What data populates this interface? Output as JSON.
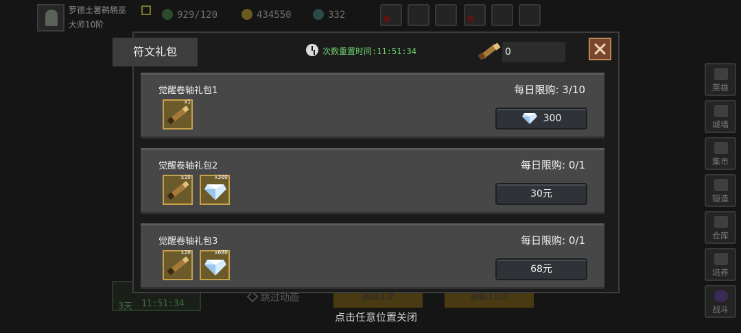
{
  "player": {
    "name": "罗德土著鹈鹕巫",
    "rank": "大师10阶"
  },
  "stats": {
    "stamina": "929/120",
    "coins": "434550",
    "gems": "332"
  },
  "side_menu": [
    "英雄",
    "城墙",
    "集市",
    "锻造",
    "仓库",
    "培养",
    "战斗"
  ],
  "background": {
    "timer_days": "3天",
    "timer_clock": "11:51:34",
    "skip_label": "跳过动画",
    "draw_once": "抽取1次",
    "draw_ten": "抽取10次"
  },
  "modal": {
    "tab_label": "符文礼包",
    "reset_label": "次数重置时间:11:51:34",
    "scroll_count": "0",
    "packs": [
      {
        "title": "觉醒卷轴礼包1",
        "limit": "每日限购: 3/10",
        "items": [
          {
            "icon": "scroll-icon",
            "qty": "x1"
          }
        ],
        "price": "300",
        "price_icon": "diamond-icon"
      },
      {
        "title": "觉醒卷轴礼包2",
        "limit": "每日限购: 0/1",
        "items": [
          {
            "icon": "scroll-icon",
            "qty": "x10"
          },
          {
            "icon": "diamond-icon",
            "qty": "x300"
          }
        ],
        "price": "30元"
      },
      {
        "title": "觉醒卷轴礼包3",
        "limit": "每日限购: 0/1",
        "items": [
          {
            "icon": "scroll-icon",
            "qty": "x20"
          },
          {
            "icon": "diamond-icon",
            "qty": "x680"
          }
        ],
        "price": "68元"
      }
    ]
  },
  "close_hint": "点击任意位置关闭",
  "colors": {
    "accent_green": "#6fd36f",
    "slot_gold": "#c7a24a",
    "close_red": "#7a4632"
  }
}
